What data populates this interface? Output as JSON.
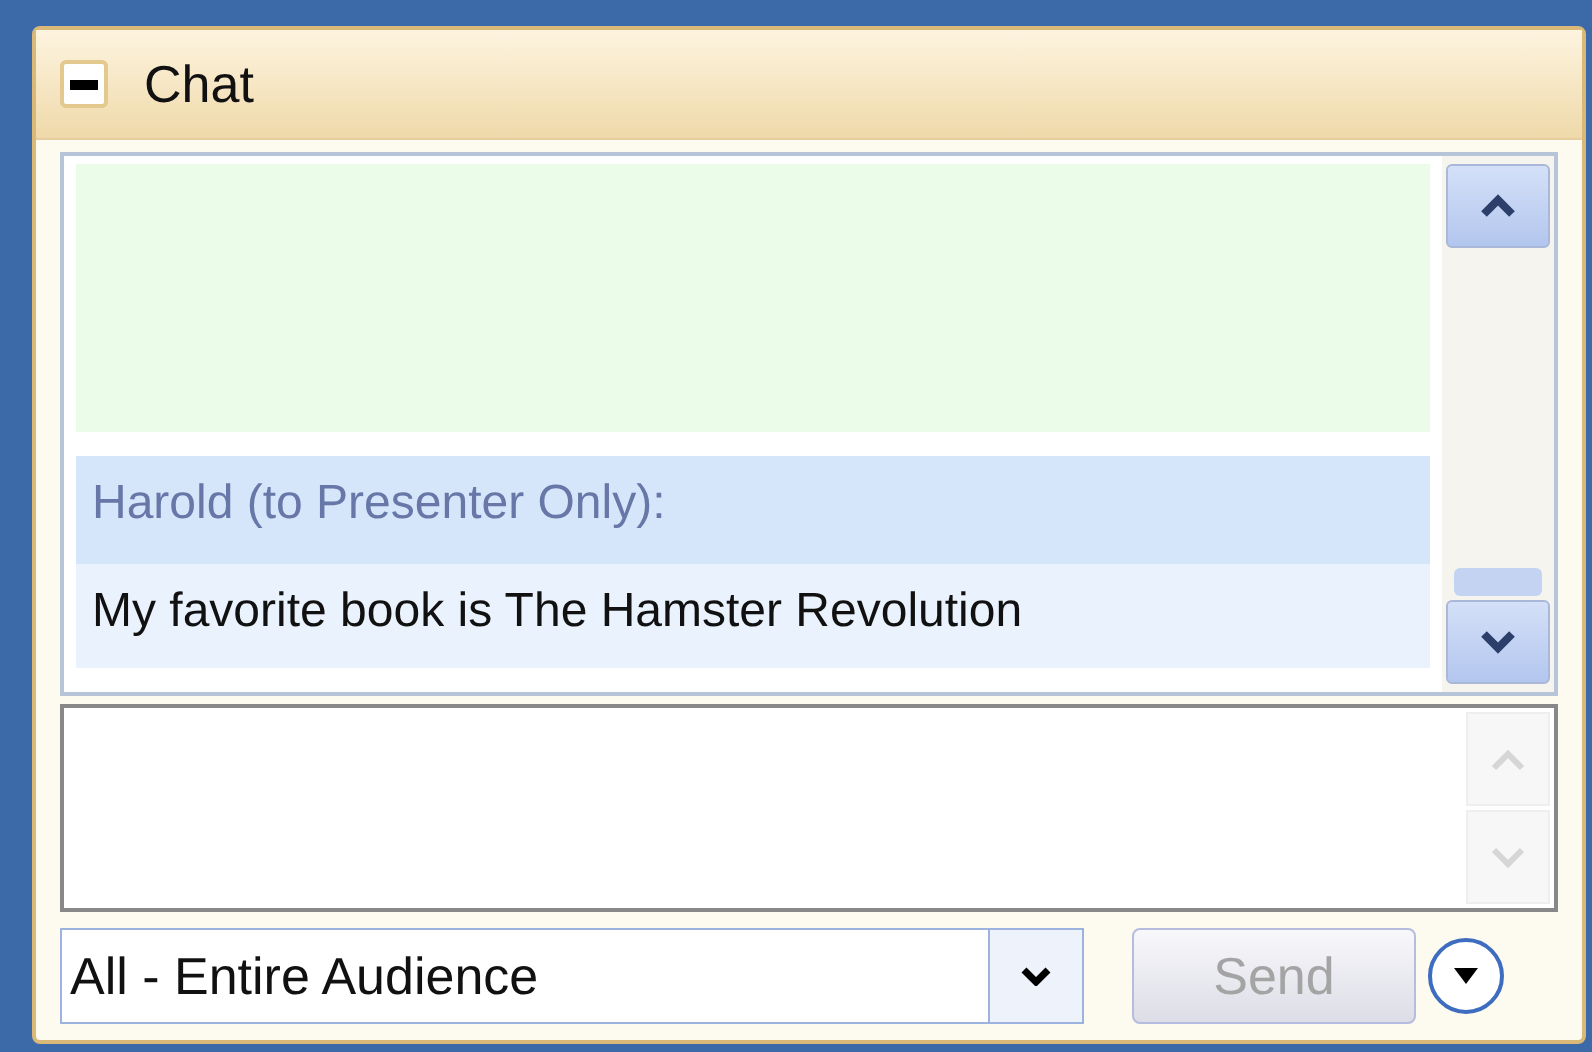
{
  "panel": {
    "title": "Chat",
    "expanded": true
  },
  "messages": [
    {
      "sender": "Harold (to Presenter Only):",
      "text": "My favorite book is The Hamster Revolution"
    }
  ],
  "recipient": {
    "value": "All - Entire Audience"
  },
  "send_button": {
    "label": "Send",
    "disabled": true
  }
}
